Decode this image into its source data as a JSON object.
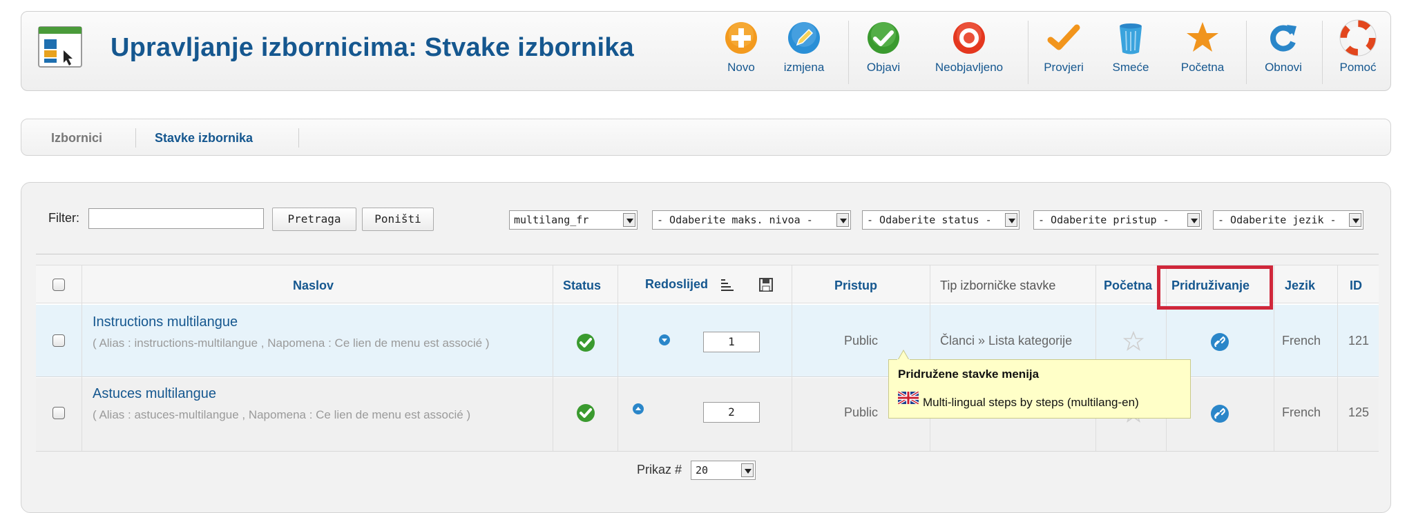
{
  "header": {
    "title": "Upravljanje izbornicima: Stvake izbornika",
    "toolbar": [
      {
        "label": "Novo",
        "icon": "add-icon",
        "color": "#f39a1e"
      },
      {
        "label": "izmjena",
        "icon": "edit-icon",
        "color": "#2a8fd6"
      },
      {
        "label": "Objavi",
        "icon": "publish-icon",
        "color": "#3a9a2f"
      },
      {
        "label": "Neobjavljeno",
        "icon": "unpublish-icon",
        "color": "#e4371f"
      },
      {
        "label": "Provjeri",
        "icon": "checkin-icon",
        "color": "#f2951c"
      },
      {
        "label": "Smeće",
        "icon": "trash-icon",
        "color": "#3aa3dd"
      },
      {
        "label": "Početna",
        "icon": "home-star-icon",
        "color": "#f0941d"
      },
      {
        "label": "Obnovi",
        "icon": "refresh-icon",
        "color": "#2a86c9"
      },
      {
        "label": "Pomoć",
        "icon": "help-icon",
        "color": "#e2461d"
      }
    ]
  },
  "tabs": [
    {
      "label": "Izbornici",
      "active": false
    },
    {
      "label": "Stavke izbornika",
      "active": true
    }
  ],
  "filter": {
    "label": "Filter:",
    "value": "",
    "search_button": "Pretraga",
    "reset_button": "Poništi",
    "selects": [
      "multilang_fr",
      "- Odaberite maks. nivoa -",
      "- Odaberite status -",
      "- Odaberite pristup -",
      "- Odaberite jezik -"
    ]
  },
  "table": {
    "columns": {
      "title": "Naslov",
      "status": "Status",
      "order": "Redoslijed",
      "access": "Pristup",
      "type": "Tip izborničke stavke",
      "home": "Početna",
      "association": "Pridruživanje",
      "language": "Jezik",
      "id": "ID"
    },
    "rows": [
      {
        "title": "Instructions multilangue",
        "alias": "( Alias : instructions-multilangue , Napomena : Ce lien de menu est associé )",
        "order": "1",
        "access": "Public",
        "type": "Članci » Lista kategorije",
        "language": "French",
        "id": "121"
      },
      {
        "title": "Astuces multilangue",
        "alias": "( Alias : astuces-multilangue , Napomena : Ce lien de menu est associé )",
        "order": "2",
        "access": "Public",
        "type": "",
        "language": "French",
        "id": "125"
      }
    ]
  },
  "tooltip": {
    "title": "Pridružene stavke menija",
    "item": "Multi-lingual steps by steps (multilang-en)"
  },
  "pagination": {
    "label": "Prikaz #",
    "value": "20"
  },
  "colors": {
    "brand_blue": "#15578f",
    "highlight_red": "#d0273a",
    "row_selected": "#e7f3fa",
    "tooltip_bg": "#ffffc8"
  }
}
